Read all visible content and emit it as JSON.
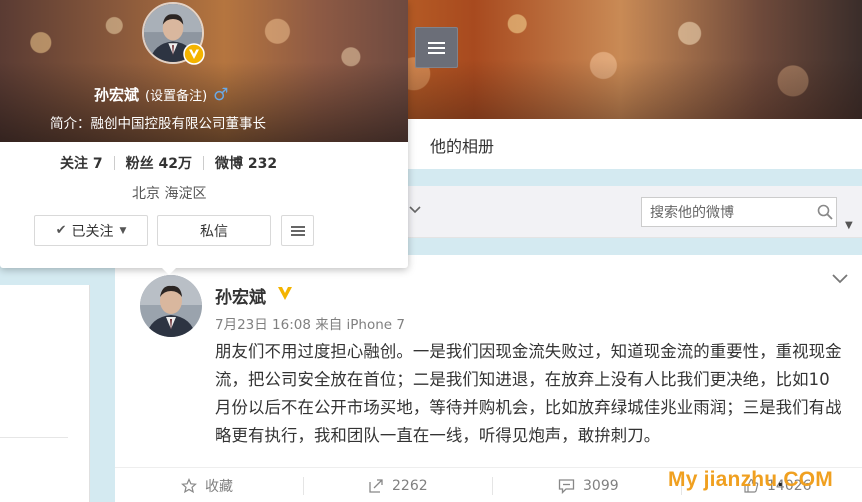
{
  "header": {
    "menu_icon": "hamburger-menu-icon"
  },
  "tabs": {
    "album_label": "他的相册"
  },
  "search": {
    "placeholder": "搜索他的微博",
    "icon": "search-icon"
  },
  "profile_card": {
    "name": "孙宏斌",
    "remark_link": "(设置备注)",
    "gender_symbol": "♂",
    "intro": "简介：融创中国控股有限公司董事长",
    "stats": {
      "following": "关注 7",
      "followers": "粉丝 42万",
      "posts": "微博 232"
    },
    "location": "北京 海淀区",
    "follow_button": "已关注",
    "message_button": "私信"
  },
  "post": {
    "author": "孙宏斌",
    "meta": "7月23日 16:08 来自 iPhone 7",
    "content": "朋友们不用过度担心融创。一是我们因现金流失败过，知道现金流的重要性，重视现金流，把公司安全放在首位；二是我们知进退，在放弃上没有人比我们更决绝，比如10月份以后不在公开市场买地，等待并购机会，比如放弃绿城佳兆业雨润；三是我们有战略更有执行，我和团队一直在一线，听得见炮声，敢拚刺刀。",
    "actions": {
      "collect": "收藏",
      "forward": "2262",
      "comment": "3099",
      "like": "14026"
    }
  },
  "watermark": {
    "prefix": "My jianzhu",
    "dot": ".",
    "suffix": "COM"
  },
  "colors": {
    "page_bg": "#d4eaf1",
    "verified_badge": "#f4b400",
    "watermark": "#f0a020"
  }
}
